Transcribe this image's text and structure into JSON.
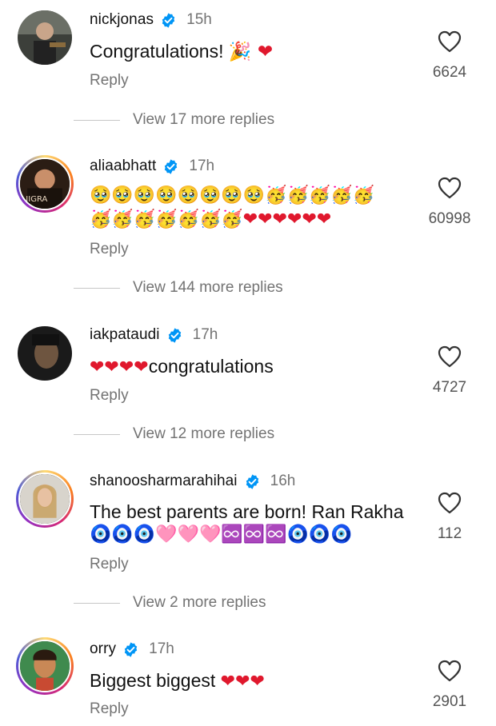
{
  "comments": [
    {
      "username": "nickjonas",
      "time": "15h",
      "text": "Congratulations!",
      "emoji": "🎉 ❤",
      "reply": "Reply",
      "likes": "6624",
      "view_replies": "View 17 more replies"
    },
    {
      "username": "aliaabhatt",
      "time": "17h",
      "emoji_line1": "🥹🥹🥹🥹🥹🥹🥹🥹🥳🥳🥳🥳🥳",
      "emoji_line2": "🥳🥳🥳🥳🥳🥳🥳❤❤❤❤❤❤",
      "reply": "Reply",
      "likes": "60998",
      "view_replies": "View 144 more replies",
      "avatar_text": "JIGRA"
    },
    {
      "username": "iakpataudi",
      "time": "17h",
      "emoji": "❤❤❤❤",
      "text": "congratulations",
      "reply": "Reply",
      "likes": "4727",
      "view_replies": "View 12 more replies"
    },
    {
      "username": "shanoosharmarahihai",
      "time": "16h",
      "text": "The best parents are born! Ran Rakha",
      "emoji_line2": "🧿🧿🧿🩷🩷🩷♾️♾️♾️🧿🧿🧿",
      "reply": "Reply",
      "likes": "112",
      "view_replies": "View 2 more replies"
    },
    {
      "username": "orry",
      "time": "17h",
      "text": "Biggest biggest",
      "emoji": "❤❤❤",
      "reply": "Reply",
      "likes": "2901"
    }
  ],
  "icons": {
    "verified": "verified-badge-icon",
    "heart": "heart-outline-icon"
  },
  "colors": {
    "verified_blue": "#0095f6",
    "heart_red": "#e0182d",
    "muted_text": "#737373"
  }
}
